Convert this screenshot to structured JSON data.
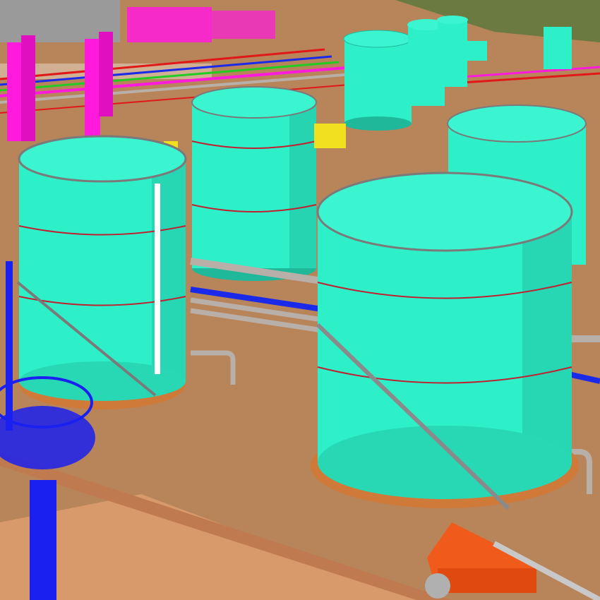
{
  "scene": {
    "colors": {
      "ground": "#b8845a",
      "ground_dark": "#9c6a45",
      "bund_wall": "#c8946a",
      "tank_body": "#2ef0c8",
      "tank_shadow": "#1fb89a",
      "tank_roof": "#3af5d0",
      "tank_base": "#d07a3a",
      "pipe_grey": "#b8b0a8",
      "pipe_magenta": "#ff1adc",
      "pipe_blue": "#1a2ae8",
      "pipe_red": "#e01818",
      "walkway_grey": "#8a8a8a",
      "lift_orange": "#f05a1a",
      "yellow_equipment": "#f0e020",
      "grass": "#6a7a40",
      "tower_blue": "#1a20f0"
    },
    "objects": [
      "storage-tank",
      "stairway",
      "handrail",
      "pipe-rack",
      "light-tower",
      "boom-lift",
      "worker-figure",
      "valve"
    ]
  }
}
